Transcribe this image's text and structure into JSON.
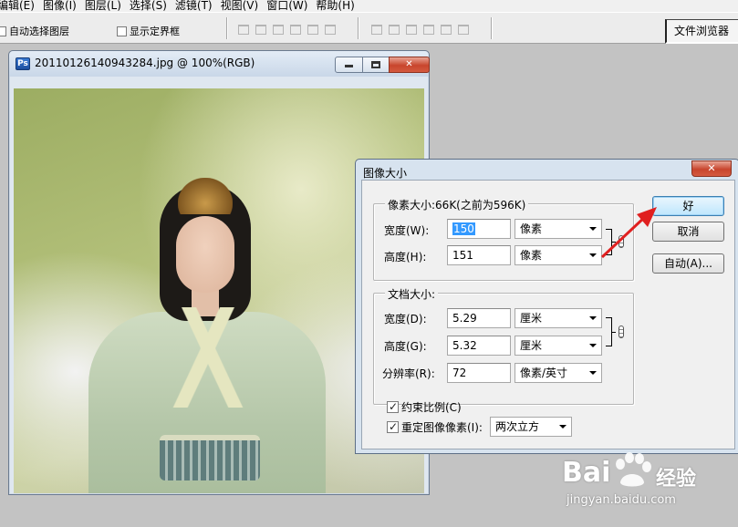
{
  "menu": {
    "items": [
      "编辑(E)",
      "图像(I)",
      "图层(L)",
      "选择(S)",
      "滤镜(T)",
      "视图(V)",
      "窗口(W)",
      "帮助(H)"
    ]
  },
  "options": {
    "auto_select_label": "自动选择图层",
    "show_bounds_label": "显示定界框",
    "file_browser_label": "文件浏览器"
  },
  "document": {
    "title": "20110126140943284.jpg @ 100%(RGB)",
    "app_icon": "Ps"
  },
  "dialog": {
    "title": "图像大小",
    "close_glyph": "✕",
    "pixel_group": {
      "legend": "像素大小:66K(之前为596K)",
      "width_label": "宽度(W):",
      "width_value": "150",
      "width_unit": "像素",
      "height_label": "高度(H):",
      "height_value": "151",
      "height_unit": "像素"
    },
    "doc_group": {
      "legend": "文档大小:",
      "width_label": "宽度(D):",
      "width_value": "5.29",
      "width_unit": "厘米",
      "height_label": "高度(G):",
      "height_value": "5.32",
      "height_unit": "厘米",
      "res_label": "分辨率(R):",
      "res_value": "72",
      "res_unit": "像素/英寸"
    },
    "constrain_label": "约束比例(C)",
    "constrain_checked": true,
    "resample_label": "重定图像像素(I):",
    "resample_checked": true,
    "resample_method": "两次立方",
    "ok_label": "好",
    "cancel_label": "取消",
    "auto_label": "自动(A)..."
  },
  "watermark": {
    "logo_left": "Bai",
    "logo_right": "经验",
    "url": "jingyan.baidu.com"
  },
  "colors": {
    "annotation_arrow": "#e02020",
    "selection": "#3399ff"
  }
}
